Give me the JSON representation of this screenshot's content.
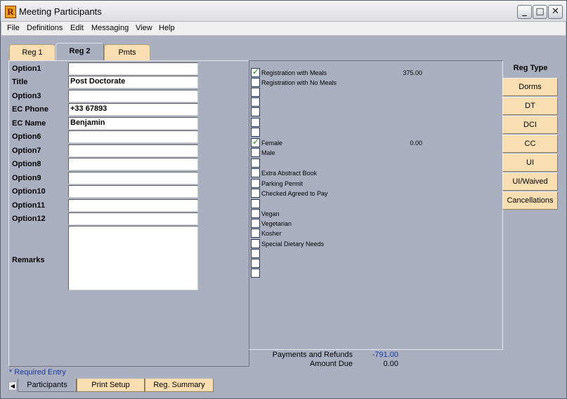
{
  "window": {
    "title": "Meeting Participants",
    "app_icon": "R"
  },
  "menu": [
    "File",
    "Definitions",
    "Edit",
    "Messaging",
    "View",
    "Help"
  ],
  "tabs": [
    {
      "label": "Reg 1"
    },
    {
      "label": "Reg 2",
      "active": true
    },
    {
      "label": "Pmts"
    }
  ],
  "fields": [
    {
      "label": "Option1",
      "value": ""
    },
    {
      "label": "Title",
      "value": "Post Doctorate"
    },
    {
      "label": "Option3",
      "value": ""
    },
    {
      "label": "EC Phone",
      "value": "+33 67893"
    },
    {
      "label": "EC Name",
      "value": "Benjamin"
    },
    {
      "label": "Option6",
      "value": ""
    },
    {
      "label": "Option7",
      "value": ""
    },
    {
      "label": "Option8",
      "value": ""
    },
    {
      "label": "Option9",
      "value": ""
    },
    {
      "label": "Option10",
      "value": ""
    },
    {
      "label": "Option11",
      "value": ""
    },
    {
      "label": "Option12",
      "value": ""
    }
  ],
  "remarks": {
    "label": "Remarks",
    "value": ""
  },
  "checkboxes": [
    {
      "label": "Registration with Meals",
      "checked": true,
      "amount": "375.00"
    },
    {
      "label": "Registration with No Meals",
      "checked": false,
      "amount": ""
    },
    {
      "label": "",
      "checked": false,
      "amount": ""
    },
    {
      "label": "",
      "checked": false,
      "amount": ""
    },
    {
      "label": "",
      "checked": false,
      "amount": ""
    },
    {
      "label": "",
      "checked": false,
      "amount": ""
    },
    {
      "label": "",
      "checked": false,
      "amount": ""
    },
    {
      "label": "Female",
      "checked": true,
      "amount": "0.00"
    },
    {
      "label": "Male",
      "checked": false,
      "amount": ""
    },
    {
      "label": "",
      "checked": false,
      "amount": ""
    },
    {
      "label": "Extra Abstract Book",
      "checked": false,
      "amount": ""
    },
    {
      "label": "Parking Permit",
      "checked": false,
      "amount": ""
    },
    {
      "label": "Checked Agreed to Pay",
      "checked": false,
      "amount": ""
    },
    {
      "label": "",
      "checked": false,
      "amount": ""
    },
    {
      "label": "Vegan",
      "checked": false,
      "amount": ""
    },
    {
      "label": "Vegetarian",
      "checked": false,
      "amount": ""
    },
    {
      "label": "Kosher",
      "checked": false,
      "amount": ""
    },
    {
      "label": "Special Dietary Needs",
      "checked": false,
      "amount": ""
    },
    {
      "label": "",
      "checked": false,
      "amount": ""
    },
    {
      "label": "",
      "checked": false,
      "amount": ""
    },
    {
      "label": "",
      "checked": false,
      "amount": ""
    }
  ],
  "reg_type": {
    "title": "Reg Type",
    "buttons": [
      "Dorms",
      "DT",
      "DCI",
      "CC",
      "UI",
      "UI/Waived",
      "Cancellations"
    ]
  },
  "summary": {
    "payments_label": "Payments and Refunds",
    "payments_value": "-791.00",
    "amount_due_label": "Amount Due",
    "amount_due_value": "0.00"
  },
  "required_note": "* Required Entry",
  "bottom_tabs": [
    {
      "label": "Participants",
      "active": true
    },
    {
      "label": "Print Setup"
    },
    {
      "label": "Reg. Summary"
    }
  ],
  "colors": {
    "background": "#aab0c0",
    "tab": "#f8deb0",
    "link_blue": "#1a3aa0",
    "check": "#1a8a1a"
  }
}
